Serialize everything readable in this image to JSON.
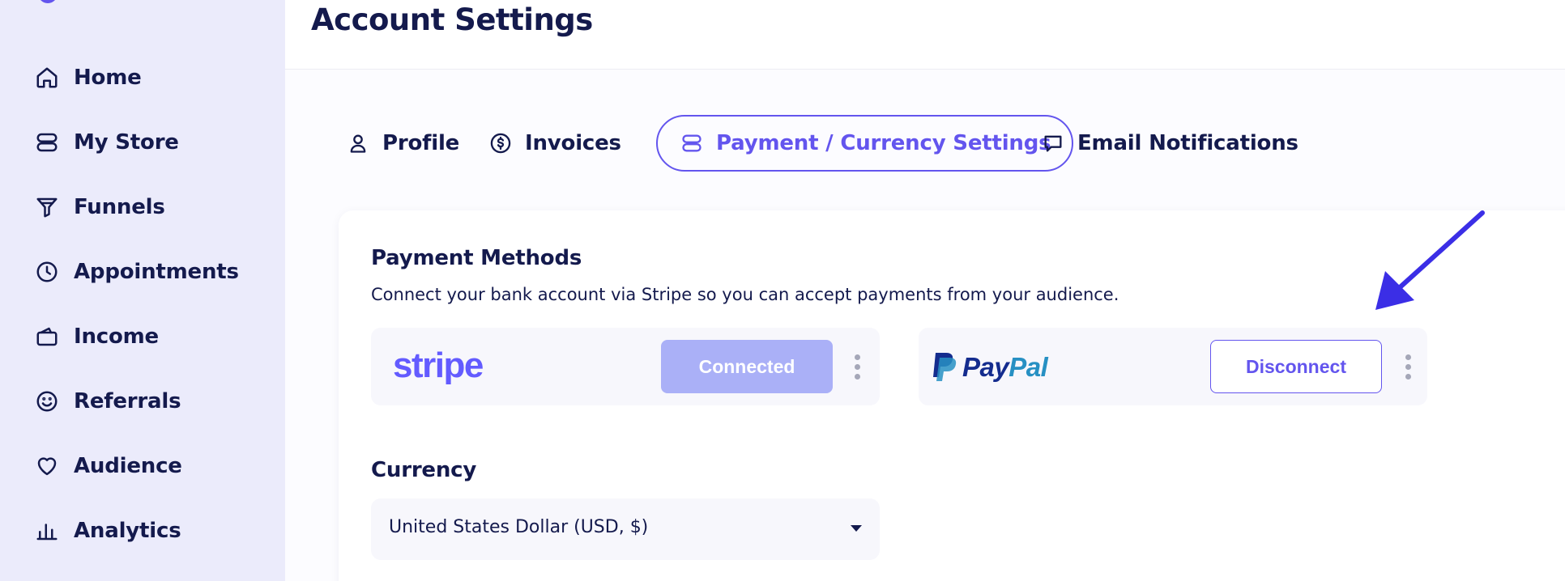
{
  "sidebar": {
    "items": [
      {
        "label": "Home",
        "icon": "home-icon"
      },
      {
        "label": "My Store",
        "icon": "store-icon"
      },
      {
        "label": "Funnels",
        "icon": "funnel-icon"
      },
      {
        "label": "Appointments",
        "icon": "clock-icon"
      },
      {
        "label": "Income",
        "icon": "wallet-icon"
      },
      {
        "label": "Referrals",
        "icon": "smile-icon"
      },
      {
        "label": "Audience",
        "icon": "heart-icon"
      },
      {
        "label": "Analytics",
        "icon": "bar-chart-icon"
      }
    ]
  },
  "header": {
    "title": "Account Settings"
  },
  "tabs": [
    {
      "label": "Profile",
      "icon": "user-icon",
      "active": false
    },
    {
      "label": "Invoices",
      "icon": "dollar-circle-icon",
      "active": false
    },
    {
      "label": "Payment / Currency Settings",
      "icon": "stack-icon",
      "active": true
    },
    {
      "label": "Email Notifications",
      "icon": "chat-bubble-icon",
      "active": false
    }
  ],
  "payment": {
    "title": "Payment Methods",
    "description": "Connect your bank account via Stripe so you can accept payments from your audience.",
    "stripe": {
      "logo_text": "stripe",
      "button_label": "Connected"
    },
    "paypal": {
      "logo_text_a": "Pay",
      "logo_text_b": "Pal",
      "button_label": "Disconnect"
    }
  },
  "currency": {
    "title": "Currency",
    "selected": "United States Dollar (USD, $)"
  },
  "colors": {
    "accent": "#6355ee",
    "sidebar_bg": "#ebebfb",
    "text": "#141a4d",
    "connected_bg": "#aab0f7",
    "annotation_arrow": "#3b2ee6"
  }
}
